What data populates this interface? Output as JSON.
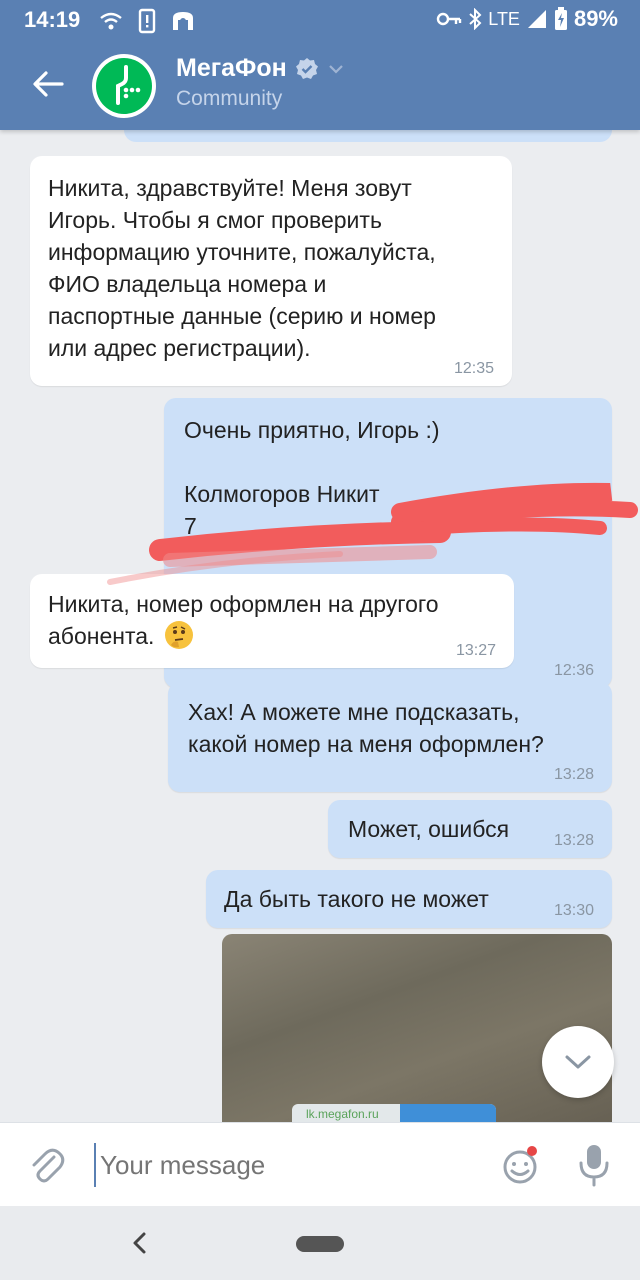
{
  "status_bar": {
    "time": "14:19",
    "network": "LTE",
    "battery": "89%"
  },
  "header": {
    "title": "МегаФон",
    "subtitle": "Community",
    "brand_color": "#00b956",
    "bar_color": "#5a80b3"
  },
  "messages": [
    {
      "direction": "incoming",
      "text": "Никита, здравствуйте! Меня зовут\nИгорь. Чтобы я смог проверить\nинформацию уточните, пожалуйста,\nФИО владельца номера и\nпаспортные данные (серию и номер\nили адрес регистрации).",
      "time": "12:35"
    },
    {
      "direction": "outgoing",
      "text": "Очень приятно, Игорь :)\n\nКолмогоров Никит\n7",
      "time": "12:36"
    },
    {
      "direction": "incoming",
      "text": "Никита, номер оформлен на другого\nабонента.",
      "emoji": "thinking-face",
      "time": "13:27"
    },
    {
      "direction": "outgoing",
      "text": "Хах! А можете мне подсказать,\nкакой номер на меня оформлен?",
      "time": "13:28"
    },
    {
      "direction": "outgoing",
      "text": "Может, ошибся",
      "time": "13:28"
    },
    {
      "direction": "outgoing",
      "text": "Да быть такого не может",
      "time": "13:30"
    }
  ],
  "photo_caption": "lk.megafon.ru",
  "composer": {
    "placeholder": "Your message"
  }
}
